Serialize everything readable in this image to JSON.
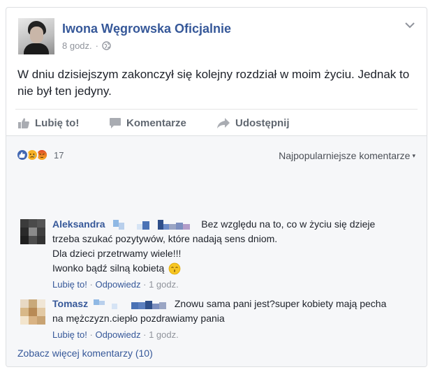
{
  "post": {
    "page_name": "Iwona Węgrowska Oficjalnie",
    "time": "8 godz.",
    "separator": "·",
    "text": "W dniu dzisiejszym zakonczył się kolejny rozdział w moim życiu. Jednak to nie był ten jedyny."
  },
  "actions": {
    "like": "Lubię to!",
    "comment": "Komentarze",
    "share": "Udostępnij"
  },
  "reactions": {
    "count": "17",
    "sort_label": "Najpopularniejsze komentarze",
    "colors": {
      "like": "#4267b2",
      "sad": "#f7b125",
      "angry": "#e9710f"
    }
  },
  "comments": [
    {
      "author": "Aleksandra",
      "text_lines": [
        "Bez względu na to, co w życiu się dzieje",
        "trzeba szukać pozytywów, które nadają sens dniom.",
        "Dla dzieci przetrwamy wiele!!!",
        "Iwonko bądź silną kobietą"
      ],
      "like": "Lubię to!",
      "reply": "Odpowiedz",
      "time": "1 godz."
    },
    {
      "author": "Tomasz",
      "text_lines": [
        "Znowu sama pani jest?super kobiety mają pecha",
        "na mężczyzn.ciepło pozdrawiamy pania"
      ],
      "like": "Lubię to!",
      "reply": "Odpowiedz",
      "time": "1 godz."
    }
  ],
  "see_more": "Zobacz więcej komentarzy (10)"
}
